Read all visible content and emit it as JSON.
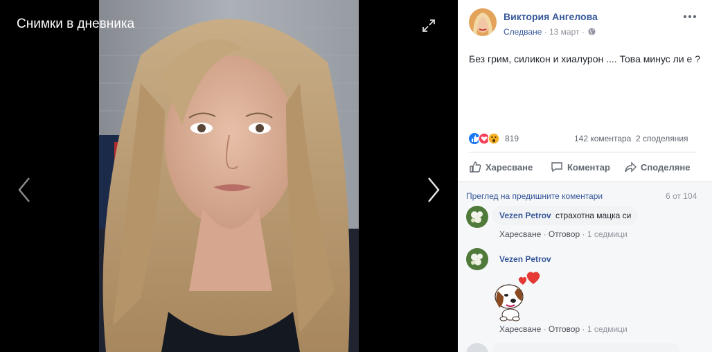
{
  "viewer": {
    "album_title": "Снимки в дневника"
  },
  "post": {
    "author": "Виктория Ангелова",
    "follow_label": "Следване",
    "separator": " · ",
    "date": "13 март",
    "text": "Без грим, силикон и хиалурон .... Това минус ли е ?",
    "reaction_count": "819",
    "comments_count": "142 коментара",
    "shares_count": "2 споделяния",
    "actions": {
      "like": "Харесване",
      "comment": "Коментар",
      "share": "Споделяне"
    }
  },
  "comments": {
    "prev_label": "Преглед на предишните коментари",
    "count_label": "6 от 104",
    "items": [
      {
        "name": "Vezen Petrov",
        "text": "страхотна мацка си",
        "like": "Харесване",
        "reply": "Отговор",
        "time": "1 седмици",
        "sep": " · "
      },
      {
        "name": "Vezen Petrov",
        "text": "",
        "like": "Харесване",
        "reply": "Отговор",
        "time": "1 седмици",
        "sep": " · "
      }
    ]
  },
  "colors": {
    "link_blue": "#365899",
    "like_blue": "#1877f2",
    "love_red": "#f33e58",
    "wow_yellow": "#f7b125"
  },
  "icons": [
    "expand-icon",
    "chevron-left-icon",
    "chevron-right-icon",
    "more-icon",
    "globe-icon",
    "like-reaction-icon",
    "love-reaction-icon",
    "wow-reaction-icon",
    "thumbs-up-icon",
    "comment-icon",
    "share-icon"
  ]
}
